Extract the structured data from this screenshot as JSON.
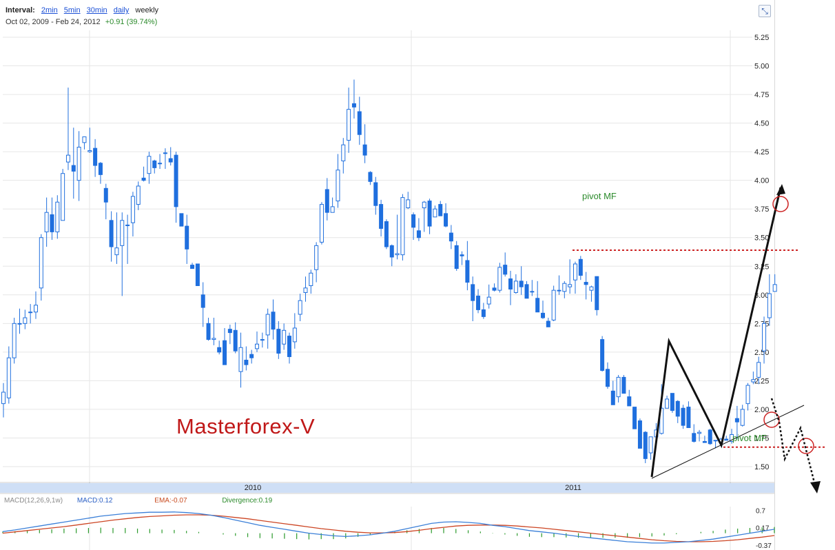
{
  "header": {
    "interval_label": "Interval:",
    "intervals": [
      "2min",
      "5min",
      "30min",
      "daily"
    ],
    "current_interval": "weekly",
    "start_date": "Oct 02, 2009",
    "separator": "-",
    "end_date": "Feb 24, 2012",
    "change": "+0.91 (39.74%)"
  },
  "watermark": "Masterforex-V",
  "annotations": {
    "pivot_label": "pivot MF",
    "pivot_upper_price": 3.39,
    "pivot_lower_price": 1.67
  },
  "macd": {
    "title": "MACD(12,26,9,1w)",
    "macd": "MACD:0.12",
    "ema": "EMA:-0.07",
    "divergence": "Divergence:0.19",
    "ticks": [
      "0.7",
      "0.17",
      "-0.37"
    ]
  },
  "colors": {
    "bull_candle": "#ffffff",
    "bear_candle": "#1f6fde",
    "candle_outline": "#1f6fde",
    "macd_line": "#3a7fd8",
    "ema_line": "#cc4422",
    "divergence_bars": "#2b9a2b",
    "pivot_lines": "#cc2222",
    "grid": "#e6e6e6"
  },
  "chart_data": {
    "type": "candlestick",
    "x_range": [
      "Oct 02, 2009",
      "Feb 24, 2012"
    ],
    "time_labels": [
      "2010",
      "2011"
    ],
    "y_ticks": [
      "5.25",
      "5.00",
      "4.75",
      "4.50",
      "4.25",
      "4.00",
      "3.75",
      "3.50",
      "3.25",
      "3.00",
      "2.75",
      "2.50",
      "2.25",
      "2.00",
      "1.75",
      "1.50"
    ],
    "ylim": [
      1.45,
      5.32
    ],
    "ohlc": [
      [
        2.05,
        2.15,
        1.93,
        2.23
      ],
      [
        2.1,
        2.45,
        2.05,
        2.55
      ],
      [
        2.45,
        2.75,
        2.4,
        2.8
      ],
      [
        2.75,
        2.75,
        2.66,
        2.88
      ],
      [
        2.75,
        2.8,
        2.7,
        2.87
      ],
      [
        2.85,
        2.85,
        2.75,
        2.92
      ],
      [
        2.85,
        2.91,
        2.79,
        3.03
      ],
      [
        3.06,
        3.5,
        2.95,
        3.53
      ],
      [
        3.55,
        3.72,
        3.42,
        3.85
      ],
      [
        3.7,
        3.55,
        3.48,
        3.85
      ],
      [
        3.55,
        3.81,
        3.49,
        3.87
      ],
      [
        3.65,
        4.06,
        3.65,
        4.1
      ],
      [
        4.16,
        4.22,
        4.09,
        4.81
      ],
      [
        4.13,
        4.08,
        3.84,
        4.46
      ],
      [
        4.0,
        4.29,
        3.82,
        4.43
      ],
      [
        4.33,
        4.38,
        4.27,
        4.37
      ],
      [
        4.25,
        4.26,
        4.24,
        4.46
      ],
      [
        4.28,
        4.13,
        4.03,
        4.36
      ],
      [
        4.15,
        4.05,
        3.97,
        4.16
      ],
      [
        3.93,
        3.81,
        3.66,
        3.97
      ],
      [
        3.65,
        3.42,
        3.29,
        3.73
      ],
      [
        3.35,
        3.41,
        3.27,
        3.72
      ],
      [
        3.43,
        3.65,
        2.99,
        3.72
      ],
      [
        3.61,
        3.61,
        3.27,
        3.7
      ],
      [
        3.63,
        3.86,
        3.51,
        3.9
      ],
      [
        3.79,
        3.95,
        3.74,
        3.99
      ],
      [
        4.02,
        4.0,
        3.99,
        4.12
      ],
      [
        4.06,
        4.21,
        3.97,
        4.25
      ],
      [
        4.17,
        4.11,
        4.06,
        4.18
      ],
      [
        4.15,
        4.15,
        4.1,
        4.23
      ],
      [
        4.24,
        4.24,
        4.1,
        4.28
      ],
      [
        4.19,
        4.16,
        4.13,
        4.29
      ],
      [
        4.22,
        3.77,
        3.63,
        4.25
      ],
      [
        3.71,
        3.6,
        3.65,
        3.7
      ],
      [
        3.6,
        3.4,
        3.27,
        3.7
      ],
      [
        3.26,
        3.23,
        3.26,
        3.28
      ],
      [
        3.27,
        3.08,
        3.09,
        3.27
      ],
      [
        3.0,
        2.89,
        2.72,
        3.11
      ],
      [
        2.75,
        2.61,
        2.6,
        2.8
      ],
      [
        2.61,
        2.62,
        2.56,
        2.8
      ],
      [
        2.54,
        2.5,
        2.48,
        2.6
      ],
      [
        2.6,
        2.39,
        2.41,
        2.71
      ],
      [
        2.7,
        2.67,
        2.57,
        2.74
      ],
      [
        2.69,
        2.51,
        2.49,
        2.76
      ],
      [
        2.33,
        2.54,
        2.19,
        2.67
      ],
      [
        2.43,
        2.39,
        2.34,
        2.55
      ],
      [
        2.48,
        2.45,
        2.4,
        2.52
      ],
      [
        2.53,
        2.57,
        2.5,
        2.68
      ],
      [
        2.61,
        2.61,
        2.54,
        2.67
      ],
      [
        2.65,
        2.83,
        2.53,
        2.88
      ],
      [
        2.85,
        2.7,
        2.61,
        2.96
      ],
      [
        2.7,
        2.49,
        2.44,
        2.77
      ],
      [
        2.57,
        2.69,
        2.52,
        2.75
      ],
      [
        2.64,
        2.46,
        2.4,
        2.67
      ],
      [
        2.59,
        2.71,
        2.53,
        2.84
      ],
      [
        2.83,
        2.95,
        2.77,
        3.01
      ],
      [
        3.02,
        3.06,
        2.94,
        3.16
      ],
      [
        3.08,
        3.19,
        3.01,
        3.22
      ],
      [
        3.22,
        3.43,
        3.11,
        3.46
      ],
      [
        3.46,
        3.79,
        3.44,
        3.81
      ],
      [
        3.92,
        3.72,
        3.65,
        4.02
      ],
      [
        3.72,
        3.77,
        3.73,
        3.85
      ],
      [
        3.82,
        4.09,
        3.76,
        4.23
      ],
      [
        4.17,
        4.31,
        4.06,
        4.37
      ],
      [
        4.35,
        4.62,
        4.24,
        4.81
      ],
      [
        4.67,
        4.64,
        4.54,
        4.88
      ],
      [
        4.6,
        4.4,
        4.31,
        4.73
      ],
      [
        4.31,
        4.22,
        4.15,
        4.49
      ],
      [
        4.07,
        3.99,
        3.96,
        4.08
      ],
      [
        3.98,
        3.78,
        3.7,
        4.03
      ],
      [
        3.79,
        3.58,
        3.51,
        3.83
      ],
      [
        3.64,
        3.42,
        3.4,
        3.66
      ],
      [
        3.43,
        3.33,
        3.25,
        3.44
      ],
      [
        3.35,
        3.36,
        3.31,
        3.7
      ],
      [
        3.35,
        3.85,
        3.3,
        3.88
      ],
      [
        3.76,
        3.83,
        3.75,
        3.9
      ],
      [
        3.7,
        3.59,
        3.48,
        3.72
      ],
      [
        3.56,
        3.5,
        3.47,
        3.67
      ],
      [
        3.76,
        3.81,
        3.55,
        3.82
      ],
      [
        3.82,
        3.6,
        3.53,
        3.84
      ],
      [
        3.68,
        3.75,
        3.7,
        3.78
      ],
      [
        3.79,
        3.69,
        3.69,
        3.82
      ],
      [
        3.71,
        3.6,
        3.59,
        3.8
      ],
      [
        3.54,
        3.47,
        3.4,
        3.61
      ],
      [
        3.43,
        3.23,
        3.21,
        3.47
      ],
      [
        3.35,
        3.34,
        3.26,
        3.38
      ],
      [
        3.3,
        3.11,
        3.04,
        3.47
      ],
      [
        3.09,
        2.95,
        2.77,
        3.16
      ],
      [
        2.99,
        2.87,
        2.84,
        3.05
      ],
      [
        2.87,
        2.81,
        2.79,
        2.93
      ],
      [
        2.92,
        2.98,
        2.88,
        3.09
      ],
      [
        3.06,
        3.04,
        3.03,
        3.1
      ],
      [
        3.04,
        3.24,
        3.02,
        3.28
      ],
      [
        3.26,
        3.18,
        3.16,
        3.37
      ],
      [
        3.14,
        3.05,
        2.91,
        3.21
      ],
      [
        3.02,
        3.12,
        3.01,
        3.18
      ],
      [
        3.12,
        3.07,
        3.0,
        3.25
      ],
      [
        3.09,
        2.97,
        2.98,
        3.12
      ],
      [
        3.03,
        3.03,
        2.99,
        3.13
      ],
      [
        2.97,
        2.85,
        2.85,
        3.12
      ],
      [
        2.84,
        2.8,
        2.79,
        2.95
      ],
      [
        2.77,
        2.72,
        2.72,
        2.8
      ],
      [
        2.78,
        3.04,
        2.77,
        3.08
      ],
      [
        3.04,
        3.04,
        3.0,
        3.17
      ],
      [
        3.03,
        3.1,
        2.97,
        3.12
      ],
      [
        3.07,
        3.09,
        3.01,
        3.31
      ],
      [
        3.13,
        3.27,
        3.01,
        3.29
      ],
      [
        3.31,
        3.17,
        3.13,
        3.34
      ],
      [
        3.11,
        3.09,
        2.96,
        3.2
      ],
      [
        3.04,
        3.07,
        2.94,
        3.08
      ],
      [
        3.16,
        2.87,
        2.82,
        3.16
      ],
      [
        2.61,
        2.34,
        2.33,
        2.64
      ],
      [
        2.35,
        2.2,
        2.18,
        2.41
      ],
      [
        2.16,
        2.04,
        2.1,
        2.25
      ],
      [
        2.11,
        2.28,
        2.06,
        2.3
      ],
      [
        2.28,
        2.14,
        2.14,
        2.3
      ],
      [
        2.11,
        2.03,
        2.06,
        2.17
      ],
      [
        2.02,
        1.83,
        1.87,
        2.02
      ],
      [
        1.9,
        1.66,
        1.7,
        1.92
      ],
      [
        1.8,
        1.57,
        1.53,
        1.81
      ],
      [
        1.62,
        1.76,
        1.56,
        1.75
      ],
      [
        1.76,
        1.82,
        1.74,
        1.88
      ],
      [
        1.79,
        2.01,
        1.78,
        2.22
      ],
      [
        2.01,
        2.09,
        2.01,
        2.12
      ],
      [
        2.14,
        1.99,
        1.97,
        2.13
      ],
      [
        2.07,
        1.94,
        1.88,
        2.08
      ],
      [
        2.01,
        1.86,
        1.83,
        2.04
      ],
      [
        2.02,
        1.84,
        1.9,
        2.07
      ],
      [
        1.79,
        1.72,
        1.71,
        1.87
      ],
      [
        1.79,
        1.8,
        1.72,
        1.82
      ],
      [
        1.72,
        1.71,
        1.71,
        1.77
      ],
      [
        1.82,
        1.7,
        1.69,
        1.83
      ],
      [
        1.73,
        1.73,
        1.66,
        1.73
      ],
      [
        1.71,
        1.74,
        1.71,
        1.75
      ],
      [
        1.74,
        1.73,
        1.73,
        1.77
      ],
      [
        1.72,
        1.78,
        1.7,
        1.83
      ],
      [
        1.92,
        1.89,
        1.74,
        2.03
      ],
      [
        1.86,
        2.0,
        1.85,
        2.04
      ],
      [
        2.05,
        2.21,
        1.99,
        2.23
      ],
      [
        2.24,
        2.26,
        2.22,
        2.33
      ],
      [
        2.28,
        2.41,
        2.22,
        2.46
      ],
      [
        2.51,
        2.75,
        2.4,
        2.81
      ],
      [
        2.8,
        3.01,
        2.73,
        3.18
      ],
      [
        3.03,
        3.09,
        3.03,
        3.18
      ]
    ],
    "macd": [
      0.05,
      0.1,
      0.16,
      0.22,
      0.28,
      0.34,
      0.4,
      0.46,
      0.52,
      0.56,
      0.6,
      0.62,
      0.64,
      0.64,
      0.65,
      0.63,
      0.6,
      0.55,
      0.48,
      0.4,
      0.32,
      0.24,
      0.18,
      0.12,
      0.06,
      0.0,
      -0.04,
      -0.08,
      -0.1,
      -0.08,
      -0.05,
      0.0,
      0.06,
      0.14,
      0.22,
      0.3,
      0.34,
      0.35,
      0.33,
      0.3,
      0.24,
      0.2,
      0.14,
      0.08,
      0.04,
      0.0,
      -0.05,
      -0.1,
      -0.14,
      -0.18,
      -0.22,
      -0.26,
      -0.28,
      -0.3,
      -0.3,
      -0.28,
      -0.26,
      -0.22,
      -0.18,
      -0.12,
      -0.06,
      0.0,
      0.06,
      0.12
    ],
    "ema": [
      0.0,
      0.04,
      0.08,
      0.12,
      0.16,
      0.2,
      0.25,
      0.3,
      0.35,
      0.4,
      0.44,
      0.48,
      0.51,
      0.53,
      0.55,
      0.56,
      0.56,
      0.55,
      0.52,
      0.48,
      0.44,
      0.39,
      0.34,
      0.29,
      0.24,
      0.19,
      0.14,
      0.1,
      0.06,
      0.03,
      0.01,
      0.01,
      0.02,
      0.05,
      0.09,
      0.14,
      0.18,
      0.22,
      0.24,
      0.25,
      0.25,
      0.24,
      0.22,
      0.19,
      0.16,
      0.12,
      0.08,
      0.04,
      0.0,
      -0.04,
      -0.08,
      -0.12,
      -0.16,
      -0.2,
      -0.23,
      -0.25,
      -0.26,
      -0.26,
      -0.25,
      -0.23,
      -0.2,
      -0.16,
      -0.12,
      -0.07
    ],
    "macd_ylim": [
      -0.45,
      0.75
    ]
  }
}
